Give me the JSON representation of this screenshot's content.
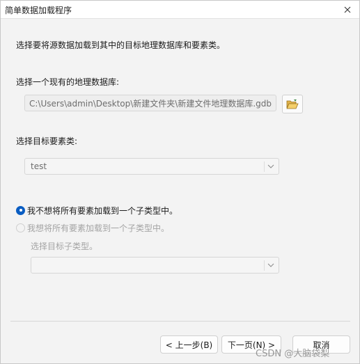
{
  "window": {
    "title": "简单数据加载程序"
  },
  "instruction": "选择要将源数据加载到其中的目标地理数据库和要素类。",
  "geodatabase": {
    "label": "选择一个现有的地理数据库:",
    "path": "C:\\Users\\admin\\Desktop\\新建文件夹\\新建文件地理数据库.gdb"
  },
  "target_featureclass": {
    "label": "选择目标要素类:",
    "value": "test"
  },
  "subtype": {
    "option_no": "我不想将所有要素加载到一个子类型中。",
    "option_yes": "我想将所有要素加载到一个子类型中。",
    "select_label": "选择目标子类型。",
    "value": ""
  },
  "buttons": {
    "back": "< 上一步(B)",
    "next": "下一页(N) >",
    "cancel": "取消"
  },
  "watermark": "CSDN @大脑袋梨",
  "colors": {
    "accent": "#0a5dc2"
  }
}
